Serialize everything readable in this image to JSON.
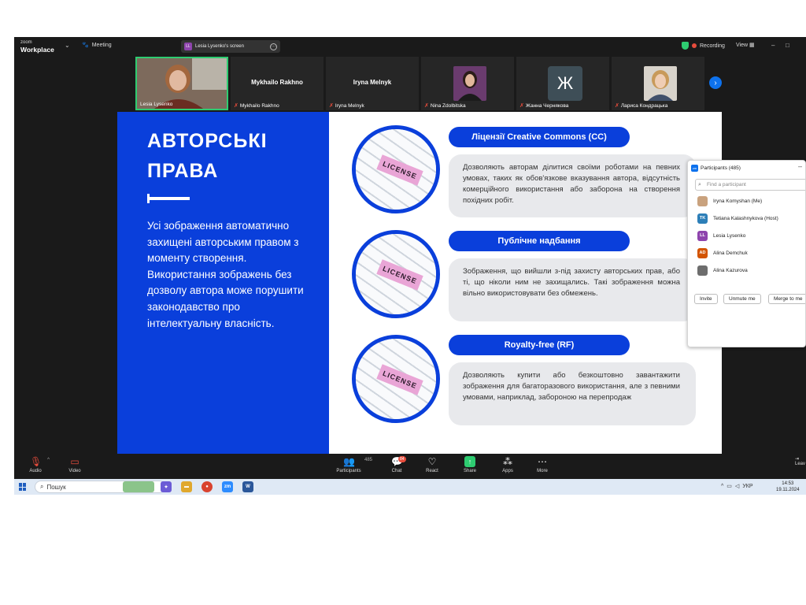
{
  "window": {
    "brand_small": "zoom",
    "brand": "Workplace",
    "meeting_label": "Meeting",
    "screen_tab_initials": "LL",
    "screen_tab_label": "Lesia Lysenko's screen",
    "recording_label": "Recording",
    "view_label": "View"
  },
  "participants_strip": [
    {
      "name": "Lesia Lysenko",
      "muted": false,
      "type": "video"
    },
    {
      "name": "Mykhailo Rakhno",
      "display": "Mykhailo Rakhno",
      "muted": true,
      "type": "name"
    },
    {
      "name": "Iryna Melnyk",
      "display": "Iryna Melnyk",
      "muted": true,
      "type": "name"
    },
    {
      "name": "Nina Zdolbitska",
      "muted": true,
      "type": "photo"
    },
    {
      "name": "Жанна Чернякова",
      "avatar_letter": "Ж",
      "muted": true,
      "type": "letter"
    },
    {
      "name": "Лариса Кондрацька",
      "muted": true,
      "type": "photo"
    }
  ],
  "slide": {
    "title_line1": "АВТОРСЬКІ",
    "title_line2": "ПРАВА",
    "body": "Усі зображення автоматично захищені авторським правом з моменту створення. Використання зображень без дозволу автора може порушити законодавство про інтелектуальну власність.",
    "image_label": "LICENSE",
    "items": [
      {
        "heading": "Ліцензії Creative Commons (CC)",
        "text": "Дозволяють авторам ділитися своїми роботами на певних умовах, таких як обов'язкове вказування автора, відсутність комерційного використання або заборона на створення похідних робіт."
      },
      {
        "heading": "Публічне надбання",
        "text": "Зображення, що вийшли з-під захисту авторських прав, або ті, що ніколи ним не захищались. Такі зображення можна вільно використовувати без обмежень."
      },
      {
        "heading": "Royalty-free (RF)",
        "text": "Дозволяють купити або безкоштовно завантажити зображення для багаторазового використання, але з певними умовами, наприклад, забороною на перепродаж"
      }
    ]
  },
  "participants_panel": {
    "title": "Participants (485)",
    "search_placeholder": "Find a participant",
    "list": [
      {
        "name": "Iryna Komyshan (Me)",
        "initials": "",
        "color": "#c9a27e"
      },
      {
        "name": "Tetiana Kalashnykova (Host)",
        "initials": "TK",
        "color": "#2d7fb8"
      },
      {
        "name": "Lesia Lysenko",
        "initials": "LL",
        "color": "#8e44ad"
      },
      {
        "name": "Alina Demchuk",
        "initials": "AD",
        "color": "#d35400"
      },
      {
        "name": "Alina Kazurova",
        "initials": "",
        "color": "#6d6d6d"
      }
    ],
    "invite_label": "Invite",
    "unmute_label": "Unmute me",
    "merge_label": "Merge to me"
  },
  "toolbar": {
    "audio": "Audio",
    "video": "Video",
    "participants": "Participants",
    "participants_count": "485",
    "chat": "Chat",
    "chat_badge": "84",
    "react": "React",
    "share": "Share",
    "apps": "Apps",
    "more": "More",
    "leave": "Leav"
  },
  "taskbar": {
    "search_label": "Пошук",
    "language": "УКР",
    "time": "14:53",
    "date": "19.11.2024"
  }
}
